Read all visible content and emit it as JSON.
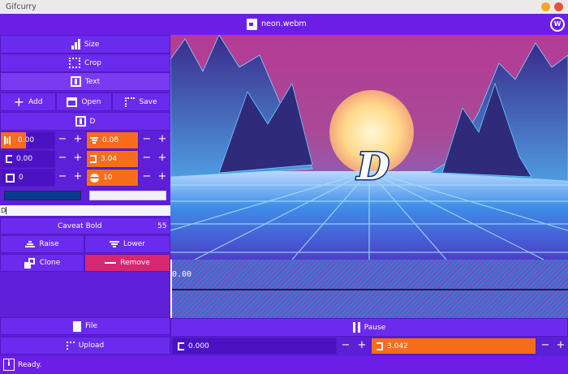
{
  "window": {
    "title": "Gifcurry"
  },
  "header": {
    "filename": "neon.webm",
    "logo_text": "W"
  },
  "sidebar": {
    "size_label": "Size",
    "crop_label": "Crop",
    "text_label": "Text",
    "add_label": "Add",
    "open_label": "Open",
    "save_label": "Save",
    "text_item_label": "D",
    "x_value": "0.00",
    "y_value": "0.08",
    "start_value": "0.00",
    "end_value": "3.04",
    "rotation_value": "0",
    "size_value": "10",
    "text_input_value": "D",
    "font_name": "Caveat Bold",
    "font_size": "55",
    "raise_label": "Raise",
    "lower_label": "Lower",
    "clone_label": "Clone",
    "remove_label": "Remove",
    "file_label": "File",
    "upload_label": "Upload",
    "plus": "+",
    "minus": "−",
    "fill_color": "#0a3a8c",
    "outline_color": "#f2f0f8"
  },
  "preview": {
    "overlay_text": "D"
  },
  "timeline": {
    "position": "0.00"
  },
  "playback": {
    "pause_label": "Pause",
    "start_time": "0.000",
    "end_time": "3.042"
  },
  "status": {
    "message": "Ready.",
    "info_icon_text": "i"
  },
  "colors": {
    "accent": "#6b1fe6",
    "orange": "#f86d1c",
    "danger": "#d8276e"
  }
}
